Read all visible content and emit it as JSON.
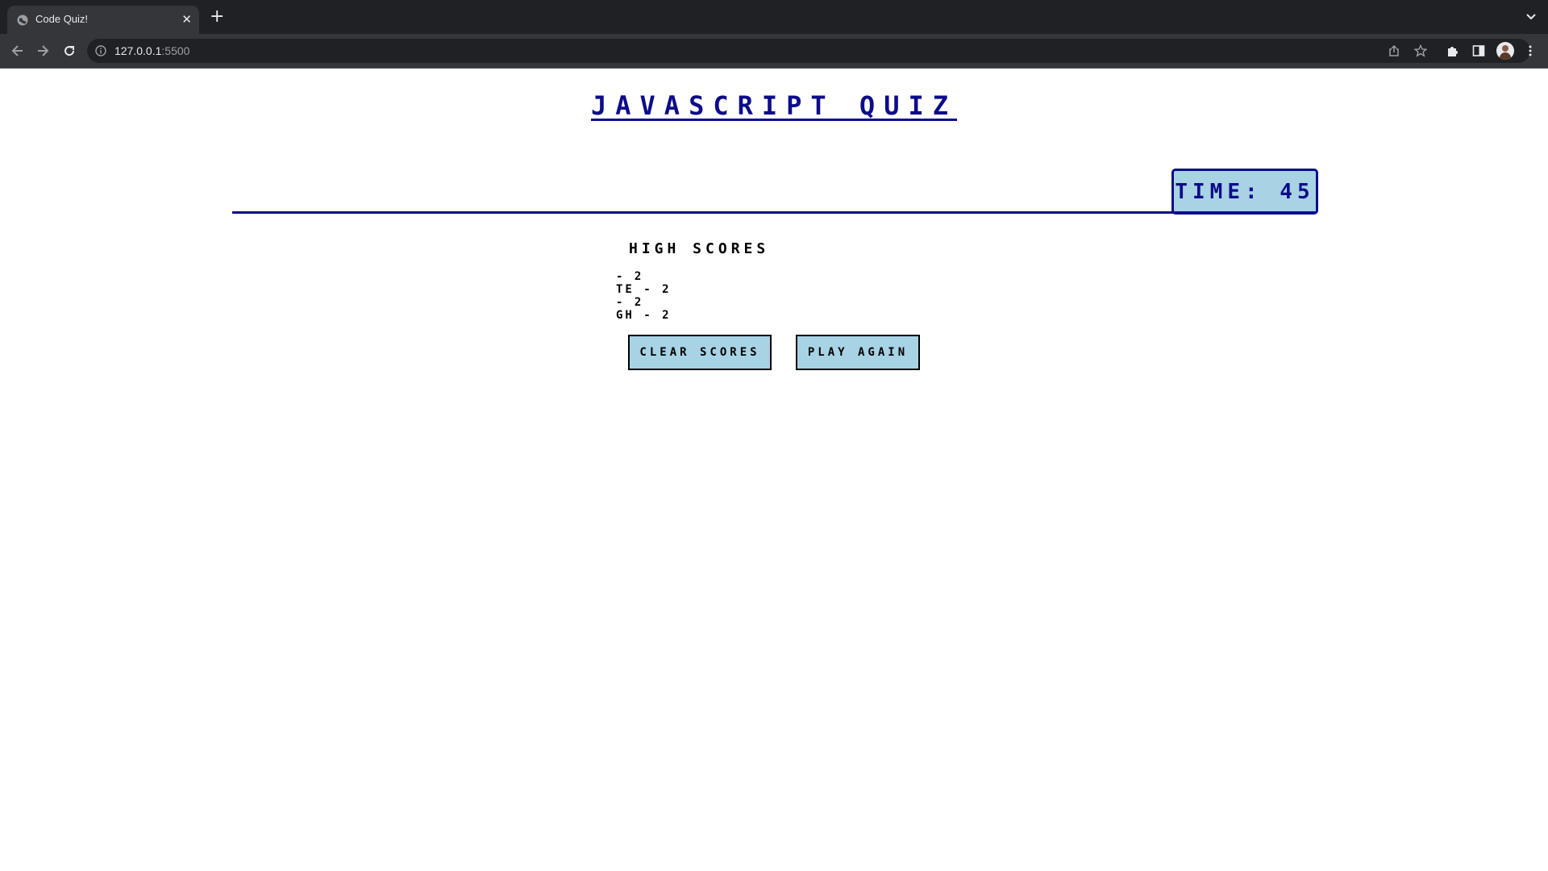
{
  "browser": {
    "tab_title": "Code Quiz!",
    "url_host": "127.0.0.1",
    "url_port": ":5500",
    "icons": [
      "globe-icon",
      "close-icon",
      "plus-icon",
      "chevron-down-icon",
      "back-arrow-icon",
      "forward-arrow-icon",
      "reload-icon",
      "info-icon",
      "share-icon",
      "star-icon",
      "puzzle-icon",
      "sidepanel-icon",
      "avatar",
      "kebab-menu-icon"
    ]
  },
  "page": {
    "title": "Javascript Quiz",
    "timer_text": "Time: 45",
    "timer_value": 45,
    "scores_heading": "High Scores",
    "scores": [
      "- 2",
      "TE - 2",
      "- 2",
      "GH - 2"
    ],
    "clear_button": "Clear Scores",
    "play_button": "Play Again"
  },
  "colors": {
    "accent": "#0c0c8a",
    "button_bg": "#a7d3e5",
    "chrome_dark": "#202124",
    "chrome_toolbar": "#35363a"
  }
}
